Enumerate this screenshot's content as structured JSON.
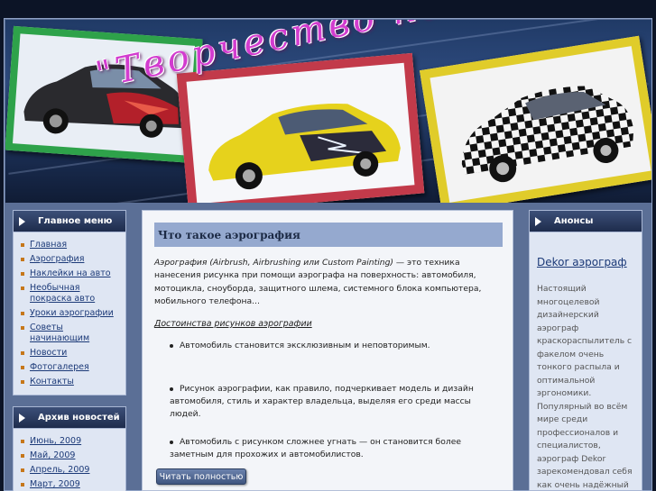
{
  "header": {
    "title": "\"Творчество на колёсах\""
  },
  "main_menu": {
    "title": "Главное меню",
    "items": [
      "Главная",
      "Аэрография",
      "Наклейки на авто",
      "Необычная покраска авто",
      "Уроки аэрографии",
      "Советы начинающим",
      "Новости",
      "Фотогалерея",
      "Контакты"
    ]
  },
  "archive": {
    "title": "Архив новостей",
    "items": [
      "Июнь, 2009",
      "Май, 2009",
      "Апрель, 2009",
      "Март, 2009"
    ]
  },
  "article": {
    "title": "Что такое аэрография",
    "intro_em": "Аэрография (Airbrush, Airbrushing или Custom Painting)",
    "intro_rest": " — это техника нанесения рисунка при помощи аэрографа на поверхность: автомобиля, мотоцикла, сноуборда, защитного шлема, системного блока компьютера, мобильного телефона...",
    "subhead": "Достоинства рисунков аэрографии",
    "points": [
      "Автомобиль становится эксклюзивным и неповторимым.",
      "Рисунок аэрографии, как правило, подчеркивает модель и дизайн автомобиля, стиль и характер владельца, выделяя его среди массы людей.",
      "Автомобиль с рисунком сложнее угнать — он становится более заметным для прохожих и автомобилистов."
    ],
    "read_more": "Читать полностью"
  },
  "announcements": {
    "title": "Анонсы",
    "link": "Dekor аэрограф",
    "text": "Настоящий многоцелевой дизайнерский аэрограф краскораспылитель с факелом очень тонкого распыла и оптимальной эргономики. Популярный во всём мире среди профессионалов и специалистов, аэрограф Dekor зарекомендовал себя как очень надёжный и..."
  },
  "colors": {
    "green_frame": "#2ea24a",
    "red_frame": "#c23a4a",
    "yellow_frame": "#e0cc2a",
    "title_script": "#d23ccf"
  }
}
